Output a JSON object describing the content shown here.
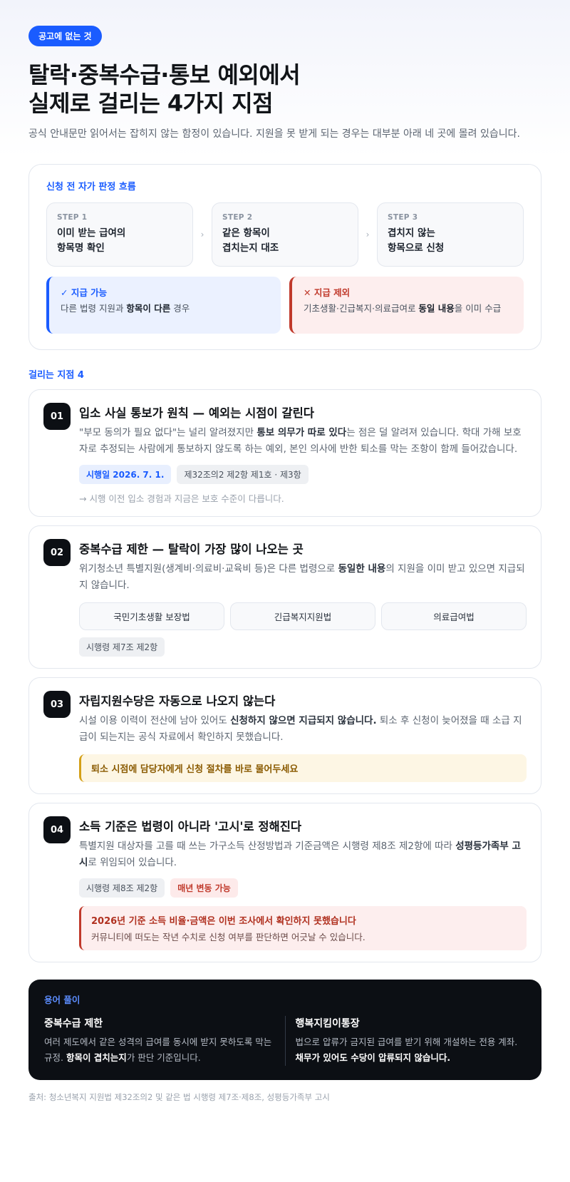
{
  "header": {
    "pill": "공고에 없는 것",
    "title_line1": "탈락·중복수급·통보 예외에서",
    "title_line2": "실제로 걸리는 4가지 지점",
    "intro": "공식 안내문만 읽어서는 잡히지 않는 함정이 있습니다. 지원을 못 받게 되는 경우는 대부분 아래 네 곳에 몰려 있습니다."
  },
  "flow": {
    "label": "신청 전 자가 판정 흐름",
    "steps": [
      {
        "num": "STEP 1",
        "line1": "이미 받는 급여의",
        "line2": "항목명 확인"
      },
      {
        "num": "STEP 2",
        "line1": "같은 항목이",
        "line2": "겹치는지 대조"
      },
      {
        "num": "STEP 3",
        "line1": "겹치지 않는",
        "line2": "항목으로 신청"
      }
    ],
    "ok": {
      "title": "✓ 지급 가능",
      "pre": "다른 법령 지원과 ",
      "bold": "항목이 다른",
      "post": " 경우"
    },
    "no": {
      "title": "✕ 지급 제외",
      "pre": "기초생활·긴급복지·의료급여로 ",
      "bold": "동일 내용",
      "post": "을 이미 수급"
    }
  },
  "points_label": "걸리는 지점 4",
  "cards": [
    {
      "num": "01",
      "title": "입소 사실 통보가 원칙 — 예외는 시점이 갈린다",
      "d_pre": "\"부모 동의가 필요 없다\"는 널리 알려졌지만 ",
      "d_bold": "통보 의무가 따로 있다",
      "d_post": "는 점은 덜 알려져 있습니다. 학대 가해 보호자로 추정되는 사람에게 통보하지 않도록 하는 예외, 본인 의사에 반한 퇴소를 막는 조항이 함께 들어갔습니다.",
      "tag1": "시행일 2026. 7. 1.",
      "tag2": "제32조의2 제2항 제1호 · 제3항",
      "note": "→ 시행 이전 입소 경험과 지금은 보호 수준이 다릅니다."
    },
    {
      "num": "02",
      "title": "중복수급 제한 — 탈락이 가장 많이 나오는 곳",
      "d_pre": "위기청소년 특별지원(생계비·의료비·교육비 등)은 다른 법령으로 ",
      "d_bold": "동일한 내용",
      "d_post": "의 지원을 이미 받고 있으면 지급되지 않습니다.",
      "laws": [
        "국민기초생활 보장법",
        "긴급복지지원법",
        "의료급여법"
      ],
      "tag1": "시행령 제7조 제2항"
    },
    {
      "num": "03",
      "title": "자립지원수당은 자동으로 나오지 않는다",
      "d_pre": "시설 이용 이력이 전산에 남아 있어도 ",
      "d_bold": "신청하지 않으면 지급되지 않습니다.",
      "d_post": " 퇴소 후 신청이 늦어졌을 때 소급 지급이 되는지는 공식 자료에서 확인하지 못했습니다.",
      "callout": "퇴소 시점에 담당자에게 신청 절차를 바로 물어두세요"
    },
    {
      "num": "04",
      "title": "소득 기준은 법령이 아니라 '고시'로 정해진다",
      "d_pre": "특별지원 대상자를 고를 때 쓰는 가구소득 산정방법과 기준금액은 시행령 제8조 제2항에 따라 ",
      "d_bold": "성평등가족부 고시",
      "d_post": "로 위임되어 있습니다.",
      "tag1": "시행령 제8조 제2항",
      "tag2": "매년 변동 가능",
      "callout_h": "2026년 기준 소득 비율·금액은 이번 조사에서 확인하지 못했습니다",
      "callout_s": "커뮤니티에 떠도는 작년 수치로 신청 여부를 판단하면 어긋날 수 있습니다."
    }
  ],
  "glossary": {
    "label": "용어 풀이",
    "items": [
      {
        "term": "중복수급 제한",
        "pre": "여러 제도에서 같은 성격의 급여를 동시에 받지 못하도록 막는 규정. ",
        "bold": "항목이 겹치는지",
        "post": "가 판단 기준입니다."
      },
      {
        "term": "행복지킴이통장",
        "pre": "법으로 압류가 금지된 급여를 받기 위해 개설하는 전용 계좌. ",
        "bold": "채무가 있어도 수당이 압류되지 않습니다.",
        "post": ""
      }
    ]
  },
  "source": "출처: 청소년복지 지원법 제32조의2 및 같은 법 시행령 제7조·제8조, 성평등가족부 고시",
  "colors": {
    "accent": "#1a5cff",
    "danger": "#c0392b",
    "warning": "#d4a017",
    "dark": "#0c0f14"
  }
}
